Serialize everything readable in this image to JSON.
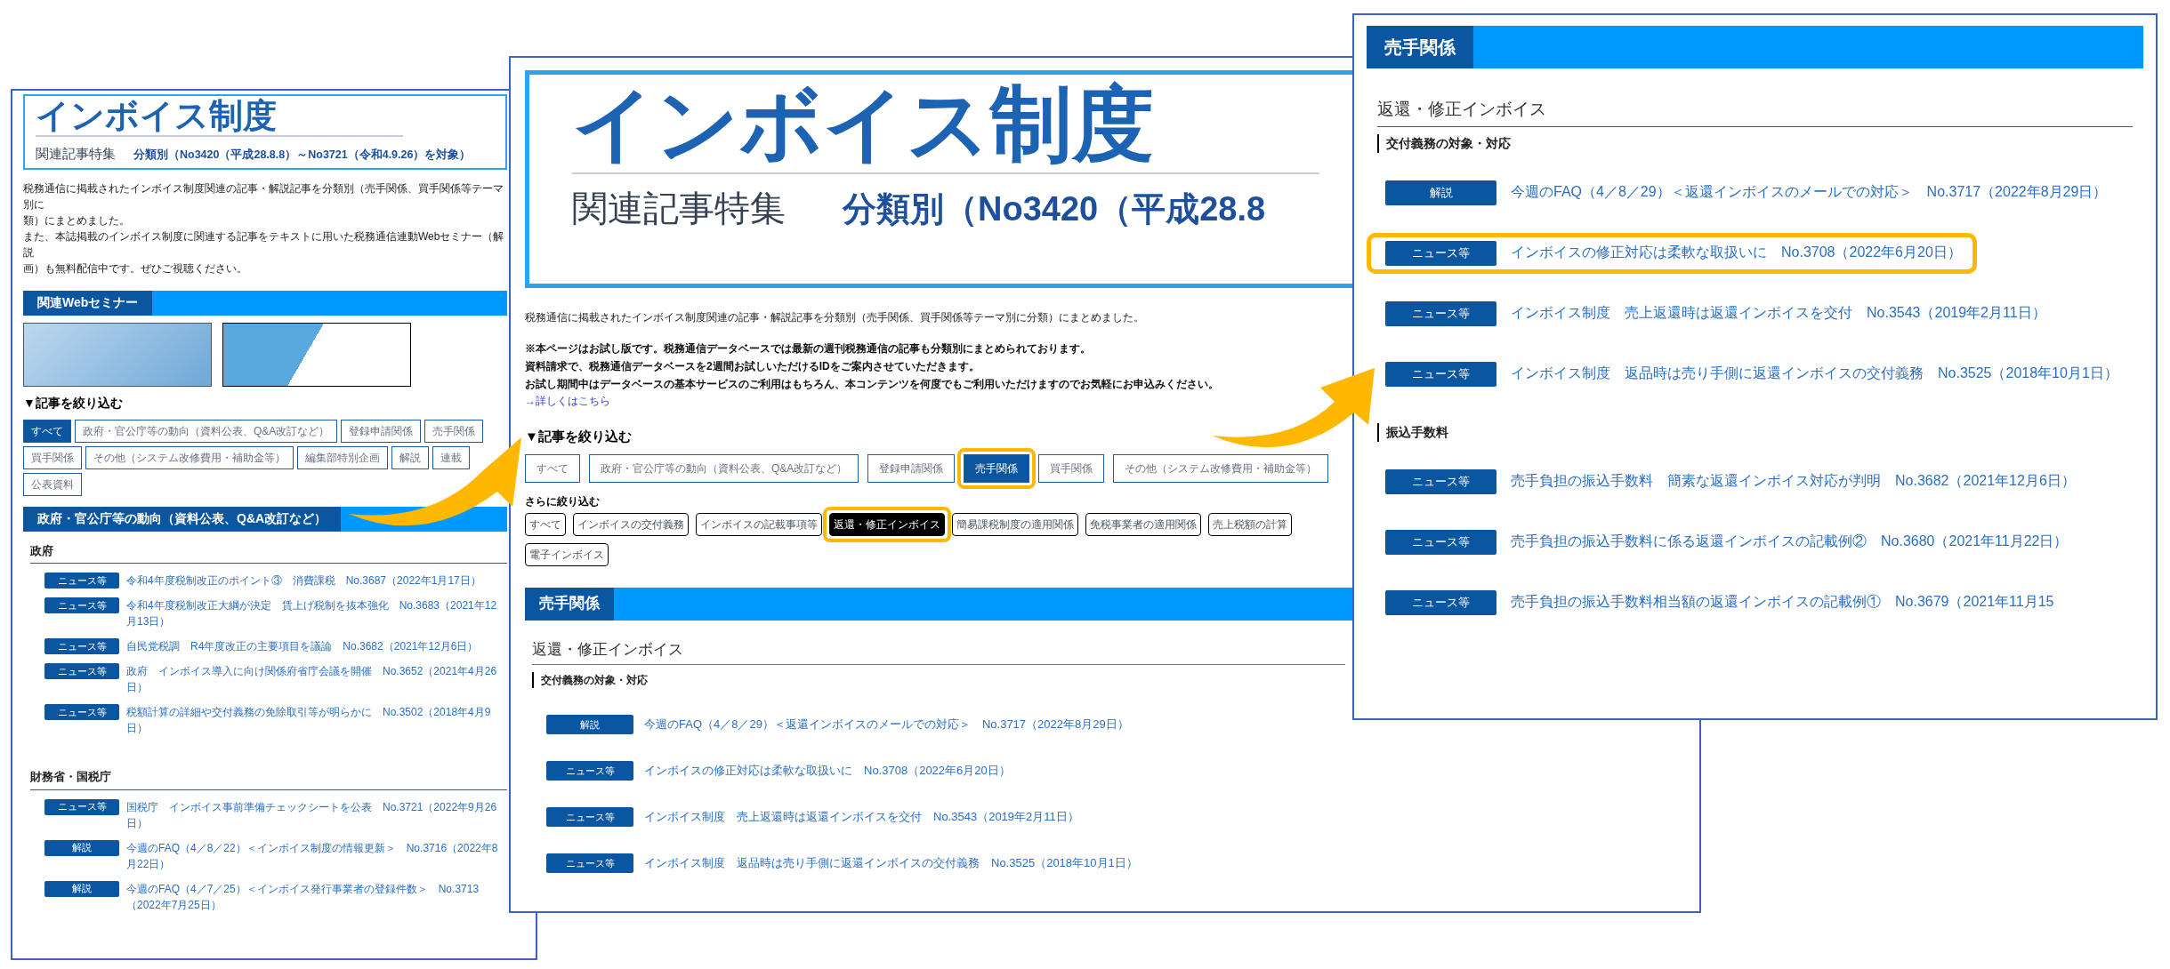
{
  "left_panel": {
    "header": {
      "title": "インボイス制度",
      "label": "関連記事特集",
      "range": "分類別（No3420（平成28.8.8）～No3721（令和4.9.26）を対象）"
    },
    "intro": [
      "税務通信に掲載されたインボイス制度関連の記事・解説記事を分類別（売手関係、買手関係等テーマ別に",
      "類）にまとめました。",
      "また、本誌掲載のインボイス制度に関連する記事をテキストに用いた税務通信連動Webセミナー（解説",
      "画）も無料配信中です。ぜひご視聴ください。"
    ],
    "seminar_bar": "関連Webセミナー",
    "filter_title": "▼記事を絞り込む",
    "filters": [
      {
        "label": "すべて",
        "selected": true
      },
      {
        "label": "政府・官公庁等の動向（資料公表、Q&A改訂など）",
        "selected": false
      },
      {
        "label": "登録申請関係",
        "selected": false
      },
      {
        "label": "売手関係",
        "selected": false
      },
      {
        "label": "買手関係",
        "selected": false
      },
      {
        "label": "その他（システム改修費用・補助金等）",
        "selected": false
      },
      {
        "label": "編集部特別企画",
        "selected": false
      },
      {
        "label": "解説",
        "selected": false
      },
      {
        "label": "連載",
        "selected": false
      },
      {
        "label": "公表資料",
        "selected": false
      }
    ],
    "section_bar": "政府・官公庁等の動向（資料公表、Q&A改訂など）",
    "groups": [
      {
        "heading": "政府",
        "items": [
          {
            "badge": "ニュース等",
            "title": "令和4年度税制改正のポイント③　消費課税　No.3687（2022年1月17日）"
          },
          {
            "badge": "ニュース等",
            "title": "令和4年度税制改正大綱が決定　賃上げ税制を抜本強化　No.3683（2021年12月13日）"
          },
          {
            "badge": "ニュース等",
            "title": "自民党税調　R4年度改正の主要項目を議論　No.3682（2021年12月6日）"
          },
          {
            "badge": "ニュース等",
            "title": "政府　インボイス導入に向け関係府省庁会議を開催　No.3652（2021年4月26日）"
          },
          {
            "badge": "ニュース等",
            "title": "税額計算の詳細や交付義務の免除取引等が明らかに　No.3502（2018年4月9日）"
          }
        ]
      },
      {
        "heading": "財務省・国税庁",
        "items": [
          {
            "badge": "ニュース等",
            "title": "国税庁　インボイス事前準備チェックシートを公表　No.3721（2022年9月26日）"
          },
          {
            "badge": "解説",
            "title": "今週のFAQ（4／8／22）＜インボイス制度の情報更新＞　No.3716（2022年8月22日）"
          },
          {
            "badge": "解説",
            "title": "今週のFAQ（4／7／25）＜インボイス発行事業者の登録件数＞　No.3713（2022年7月25日）"
          }
        ]
      }
    ]
  },
  "middle_panel": {
    "header": {
      "title": "インボイス制度",
      "label": "関連記事特集",
      "range": "分類別（No3420（平成28.8"
    },
    "intro": "税務通信に掲載されたインボイス制度関連の記事・解説記事を分類別（売手関係、買手関係等テーマ別に分類）にまとめました。",
    "notes": [
      "※本ページはお試し版です。税務通信データベースでは最新の週刊税務通信の記事も分類別にまとめられております。",
      "資料請求で、税務通信データベースを2週間お試しいただけるIDをご案内させていただきます。",
      "お試し期間中はデータベースの基本サービスのご利用はもちろん、本コンテンツを何度でもご利用いただけますのでお気軽にお申込みください。"
    ],
    "more_link": "→詳しくはこちら",
    "filter_title": "▼記事を絞り込む",
    "filters": [
      {
        "label": "すべて",
        "selected": false,
        "highlighted": false
      },
      {
        "label": "政府・官公庁等の動向（資料公表、Q&A改訂など）",
        "selected": false,
        "highlighted": false
      },
      {
        "label": "登録申請関係",
        "selected": false,
        "highlighted": false
      },
      {
        "label": "売手関係",
        "selected": true,
        "highlighted": true
      },
      {
        "label": "買手関係",
        "selected": false,
        "highlighted": false
      },
      {
        "label": "その他（システム改修費用・補助金等）",
        "selected": false,
        "highlighted": false
      }
    ],
    "subfilter_title": "さらに絞り込む",
    "subfilters": [
      {
        "label": "すべて",
        "selected": false,
        "highlighted": false
      },
      {
        "label": "インボイスの交付義務",
        "selected": false,
        "highlighted": false
      },
      {
        "label": "インボイスの記載事項等",
        "selected": false,
        "highlighted": false
      },
      {
        "label": "返還・修正インボイス",
        "selected": true,
        "highlighted": true
      },
      {
        "label": "簡易課税制度の適用関係",
        "selected": false,
        "highlighted": false
      },
      {
        "label": "免税事業者の適用関係",
        "selected": false,
        "highlighted": false
      },
      {
        "label": "売上税額の計算",
        "selected": false,
        "highlighted": false
      },
      {
        "label": "電子インボイス",
        "selected": false,
        "highlighted": false
      }
    ],
    "section_bar": "売手関係",
    "topic": "返還・修正インボイス",
    "groups": [
      {
        "heading": "交付義務の対象・対応",
        "items": [
          {
            "badge": "解説",
            "title": "今週のFAQ（4／8／29）＜返還インボイスのメールでの対応＞　No.3717（2022年8月29日）"
          },
          {
            "badge": "ニュース等",
            "title": "インボイスの修正対応は柔軟な取扱いに　No.3708（2022年6月20日）"
          },
          {
            "badge": "ニュース等",
            "title": "インボイス制度　売上返還時は返還インボイスを交付　No.3543（2019年2月11日）"
          },
          {
            "badge": "ニュース等",
            "title": "インボイス制度　返品時は売り手側に返還インボイスの交付義務　No.3525（2018年10月1日）"
          }
        ]
      }
    ]
  },
  "right_panel": {
    "section_bar": "売手関係",
    "topic": "返還・修正インボイス",
    "groups": [
      {
        "heading": "交付義務の対象・対応",
        "items": [
          {
            "badge": "解説",
            "title": "今週のFAQ（4／8／29）＜返還インボイスのメールでの対応＞　No.3717（2022年8月29日）",
            "highlighted": false
          },
          {
            "badge": "ニュース等",
            "title": "インボイスの修正対応は柔軟な取扱いに　No.3708（2022年6月20日）",
            "highlighted": true
          },
          {
            "badge": "ニュース等",
            "title": "インボイス制度　売上返還時は返還インボイスを交付　No.3543（2019年2月11日）",
            "highlighted": false
          },
          {
            "badge": "ニュース等",
            "title": "インボイス制度　返品時は売り手側に返還インボイスの交付義務　No.3525（2018年10月1日）",
            "highlighted": false
          }
        ]
      },
      {
        "heading": "振込手数料",
        "items": [
          {
            "badge": "ニュース等",
            "title": "売手負担の振込手数料　簡素な返還インボイス対応が判明　No.3682（2021年12月6日）",
            "highlighted": false
          },
          {
            "badge": "ニュース等",
            "title": "売手負担の振込手数料に係る返還インボイスの記載例②　No.3680（2021年11月22日）",
            "highlighted": false
          },
          {
            "badge": "ニュース等",
            "title": "売手負担の振込手数料相当額の返還インボイスの記載例①　No.3679（2021年11月15",
            "highlighted": false
          }
        ]
      }
    ]
  }
}
